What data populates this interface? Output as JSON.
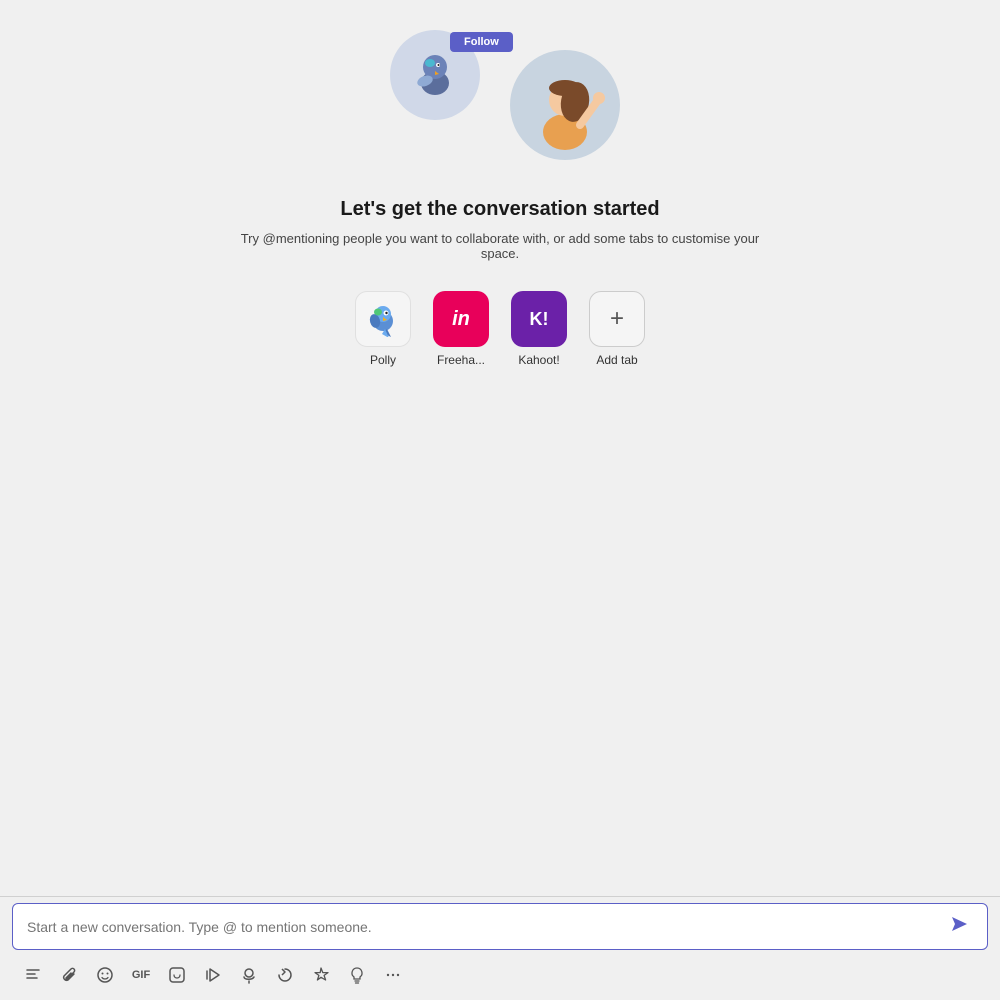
{
  "illustration": {
    "button_label": "Follow"
  },
  "heading": "Let's get the conversation started",
  "subtext": "Try @mentioning people you want to collaborate with, or add some tabs to customise your space.",
  "tabs": [
    {
      "id": "polly",
      "label": "Polly",
      "type": "polly"
    },
    {
      "id": "freehand",
      "label": "Freeha...",
      "type": "freehand"
    },
    {
      "id": "kahoot",
      "label": "Kahoot!",
      "type": "kahoot"
    },
    {
      "id": "add-tab",
      "label": "Add tab",
      "type": "add"
    }
  ],
  "input": {
    "placeholder": "Start a new conversation. Type @ to mention someone."
  },
  "toolbar": {
    "buttons": [
      {
        "name": "format-icon",
        "symbol": "✏️"
      },
      {
        "name": "attach-icon",
        "symbol": "📎"
      },
      {
        "name": "emoji-icon",
        "symbol": "🙂"
      },
      {
        "name": "gif-icon",
        "symbol": "GIF"
      },
      {
        "name": "sticker-icon",
        "symbol": "😊"
      },
      {
        "name": "schedule-icon",
        "symbol": "▷"
      },
      {
        "name": "loop-icon",
        "symbol": "⌖"
      },
      {
        "name": "loop2-icon",
        "symbol": "↺"
      },
      {
        "name": "praise-icon",
        "symbol": "🏅"
      },
      {
        "name": "idea-icon",
        "symbol": "💡"
      },
      {
        "name": "more-icon",
        "symbol": "···"
      }
    ]
  }
}
